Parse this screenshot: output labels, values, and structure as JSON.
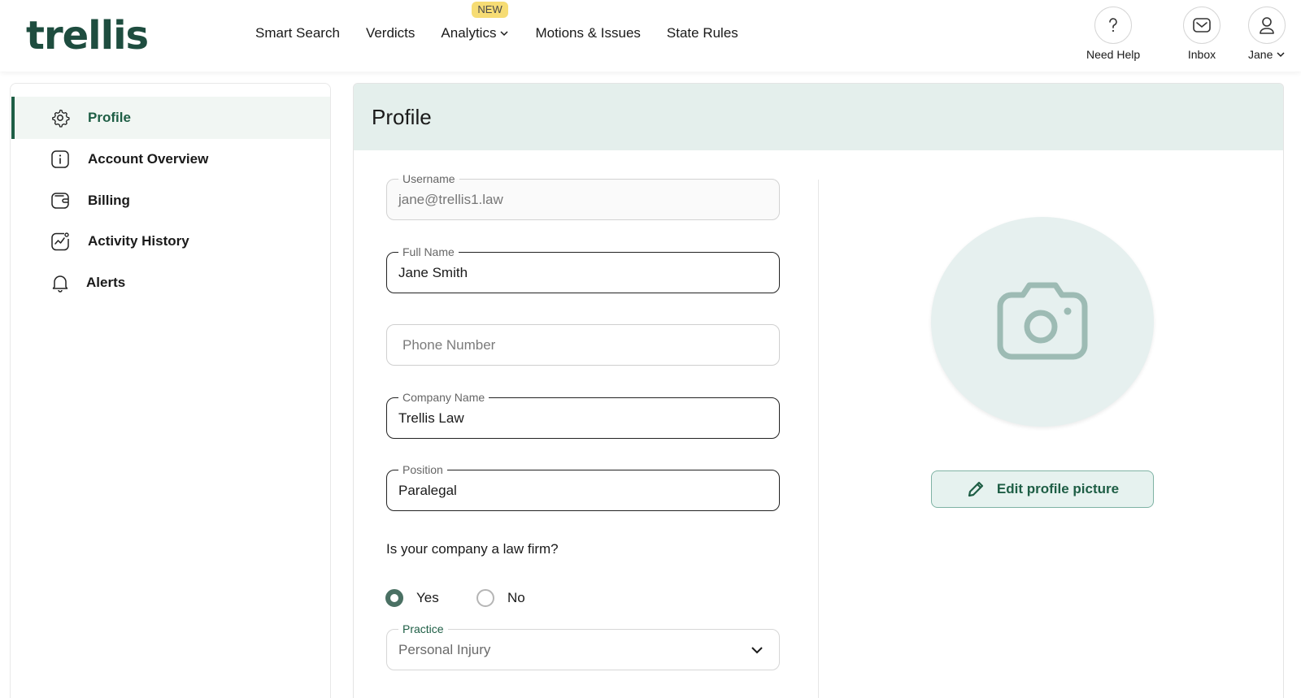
{
  "brand": {
    "logo_text": "trellis",
    "color": "#1e4d3f",
    "accent": "#1e5e45"
  },
  "nav": {
    "items": [
      {
        "label": "Smart Search"
      },
      {
        "label": "Verdicts"
      },
      {
        "label": "Analytics",
        "badge": "NEW",
        "has_dropdown": true
      },
      {
        "label": "Motions & Issues"
      },
      {
        "label": "State Rules"
      }
    ]
  },
  "header_actions": {
    "help": {
      "label": "Need Help",
      "icon": "question-icon"
    },
    "inbox": {
      "label": "Inbox",
      "icon": "mail-icon"
    },
    "user": {
      "label": "Jane",
      "icon": "user-icon"
    }
  },
  "sidebar": {
    "items": [
      {
        "label": "Profile",
        "icon": "gear-icon",
        "active": true
      },
      {
        "label": "Account Overview",
        "icon": "info-icon"
      },
      {
        "label": "Billing",
        "icon": "wallet-icon"
      },
      {
        "label": "Activity History",
        "icon": "activity-chart-icon"
      },
      {
        "label": "Alerts",
        "icon": "bell-icon"
      }
    ]
  },
  "main": {
    "title": "Profile",
    "form": {
      "username": {
        "label": "Username",
        "value": "jane@trellis1.law"
      },
      "full_name": {
        "label": "Full Name",
        "value": "Jane Smith"
      },
      "phone": {
        "placeholder": "Phone Number",
        "value": ""
      },
      "company": {
        "label": "Company Name",
        "value": "Trellis Law"
      },
      "position": {
        "label": "Position",
        "value": "Paralegal"
      },
      "law_firm_question": "Is your company a law firm?",
      "law_firm_options": [
        {
          "label": "Yes",
          "checked": true
        },
        {
          "label": "No",
          "checked": false
        }
      ],
      "practice": {
        "label": "Practice",
        "value": "Personal Injury"
      }
    },
    "picture": {
      "icon": "camera-icon",
      "edit_label": "Edit profile picture"
    }
  }
}
